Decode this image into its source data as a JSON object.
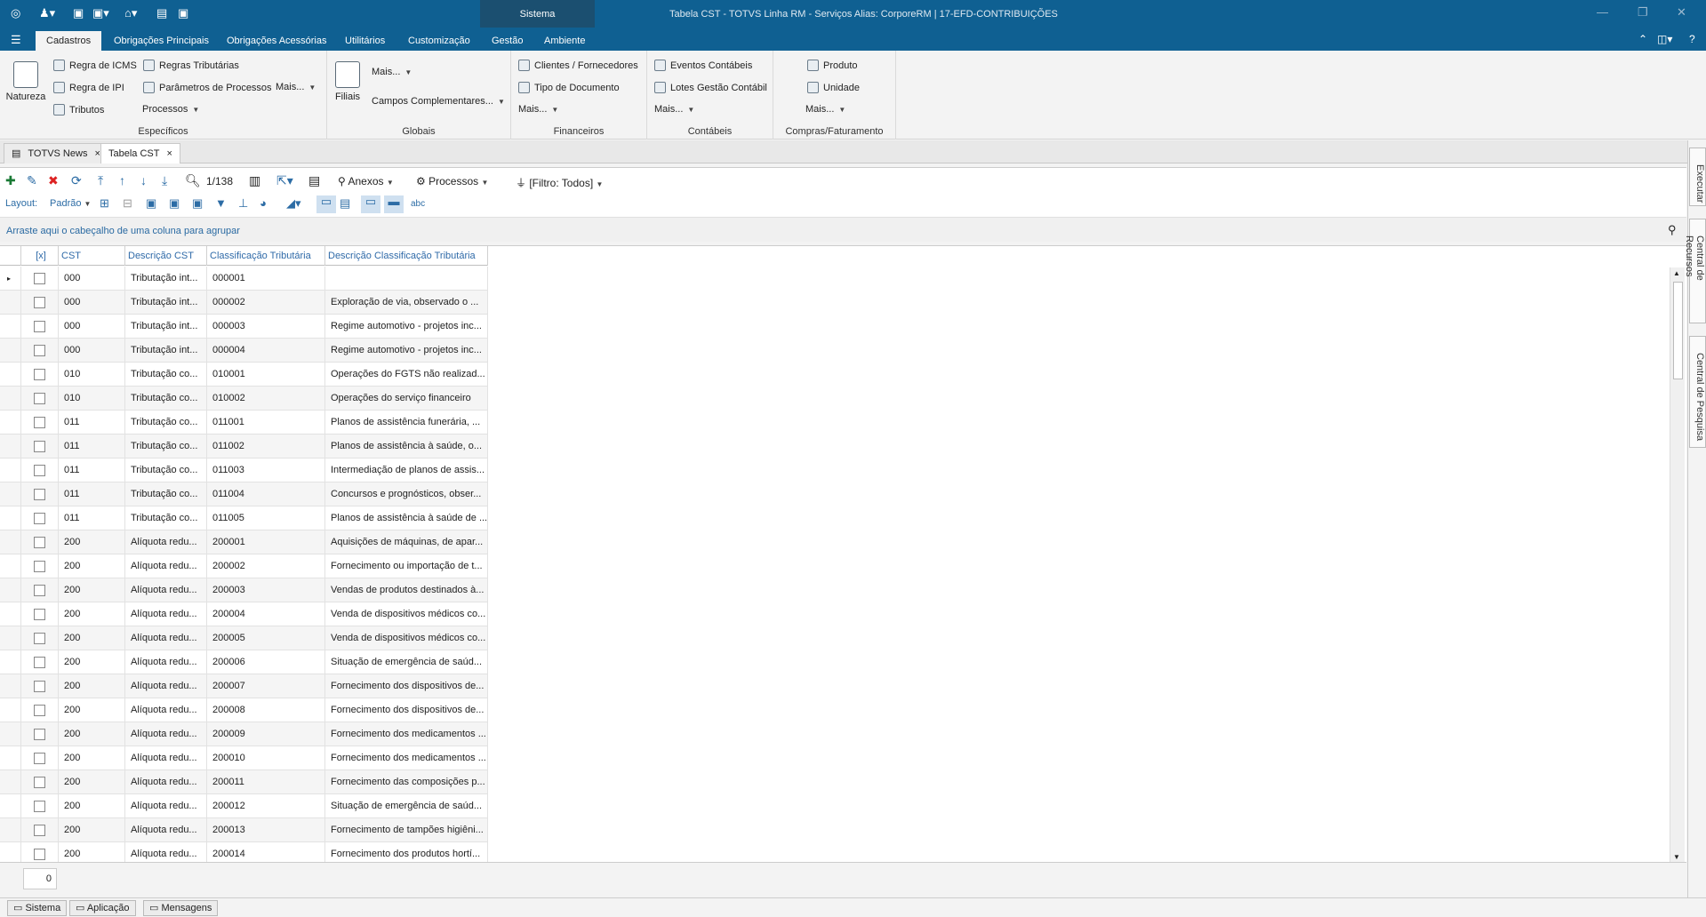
{
  "window": {
    "title": "Tabela CST - TOTVS Linha RM - Serviços  Alias: CorporeRM | 17-EFD-CONTRIBUIÇÕES",
    "context_tab": "Sistema"
  },
  "ribbon_tabs": [
    "Cadastros",
    "Obrigações Principais",
    "Obrigações Acessórias",
    "Utilitários",
    "Customização",
    "Gestão",
    "Ambiente"
  ],
  "ribbon": {
    "especificos": {
      "label": "Específicos",
      "natureza": "Natureza",
      "regra_icms": "Regra de ICMS",
      "regras_tributarias": "Regras Tributárias",
      "regra_ipi": "Regra de IPI",
      "parametros": "Parâmetros de Processos",
      "mais": "Mais...",
      "tributos": "Tributos",
      "processos": "Processos"
    },
    "globais": {
      "label": "Globais",
      "filiais": "Filiais",
      "mais": "Mais...",
      "campos": "Campos Complementares..."
    },
    "financeiros": {
      "label": "Financeiros",
      "clientes": "Clientes / Fornecedores",
      "tipo_doc": "Tipo de Documento",
      "mais": "Mais..."
    },
    "contabeis": {
      "label": "Contábeis",
      "eventos": "Eventos Contábeis",
      "lotes": "Lotes Gestão Contábil",
      "mais": "Mais..."
    },
    "compras": {
      "label": "Compras/Faturamento",
      "produto": "Produto",
      "unidade": "Unidade",
      "mais": "Mais..."
    }
  },
  "doc_tabs": [
    "TOTVS News",
    "Tabela CST"
  ],
  "toolbar": {
    "record": "1/138",
    "anexos": "Anexos",
    "processos": "Processos",
    "filtro": "[Filtro: Todos]",
    "layout_label": "Layout:",
    "layout_value": "Padrão"
  },
  "group_hint": "Arraste aqui o cabeçalho de uma coluna para agrupar",
  "columns": [
    "[x]",
    "CST",
    "Descrição CST",
    "Classificação Tributária",
    "Descrição Classificação Tributária"
  ],
  "rows": [
    [
      "000",
      "Tributação int...",
      "000001",
      ""
    ],
    [
      "000",
      "Tributação int...",
      "000002",
      "Exploração de via, observado o ..."
    ],
    [
      "000",
      "Tributação int...",
      "000003",
      "Regime automotivo - projetos inc..."
    ],
    [
      "000",
      "Tributação int...",
      "000004",
      "Regime automotivo - projetos inc..."
    ],
    [
      "010",
      "Tributação co...",
      "010001",
      "Operações do FGTS não realizad..."
    ],
    [
      "010",
      "Tributação co...",
      "010002",
      "Operações do serviço financeiro"
    ],
    [
      "011",
      "Tributação co...",
      "011001",
      "Planos de assistência funerária, ..."
    ],
    [
      "011",
      "Tributação co...",
      "011002",
      "Planos de assistência à saúde, o..."
    ],
    [
      "011",
      "Tributação co...",
      "011003",
      "Intermediação de planos de assis..."
    ],
    [
      "011",
      "Tributação co...",
      "011004",
      "Concursos e prognósticos, obser..."
    ],
    [
      "011",
      "Tributação co...",
      "011005",
      "Planos de assistência à saúde de ..."
    ],
    [
      "200",
      "Alíquota redu...",
      "200001",
      "Aquisições de máquinas, de apar..."
    ],
    [
      "200",
      "Alíquota redu...",
      "200002",
      "Fornecimento ou importação de t..."
    ],
    [
      "200",
      "Alíquota redu...",
      "200003",
      "Vendas de produtos destinados à..."
    ],
    [
      "200",
      "Alíquota redu...",
      "200004",
      "Venda de dispositivos médicos co..."
    ],
    [
      "200",
      "Alíquota redu...",
      "200005",
      "Venda de dispositivos médicos co..."
    ],
    [
      "200",
      "Alíquota redu...",
      "200006",
      "Situação de emergência de saúd..."
    ],
    [
      "200",
      "Alíquota redu...",
      "200007",
      "Fornecimento dos dispositivos de..."
    ],
    [
      "200",
      "Alíquota redu...",
      "200008",
      "Fornecimento dos dispositivos de..."
    ],
    [
      "200",
      "Alíquota redu...",
      "200009",
      "Fornecimento dos medicamentos ..."
    ],
    [
      "200",
      "Alíquota redu...",
      "200010",
      "Fornecimento dos medicamentos ..."
    ],
    [
      "200",
      "Alíquota redu...",
      "200011",
      "Fornecimento das composições p..."
    ],
    [
      "200",
      "Alíquota redu...",
      "200012",
      "Situação de emergência de saúd..."
    ],
    [
      "200",
      "Alíquota redu...",
      "200013",
      "Fornecimento de tampões higiêni..."
    ],
    [
      "200",
      "Alíquota redu...",
      "200014",
      "Fornecimento dos produtos hortí..."
    ]
  ],
  "footer_count": "0",
  "status_tabs": [
    "Sistema",
    "Aplicação",
    "Mensagens"
  ],
  "side_tabs": [
    "Executar",
    "Central de Recursos",
    "Central de Pesquisa"
  ]
}
